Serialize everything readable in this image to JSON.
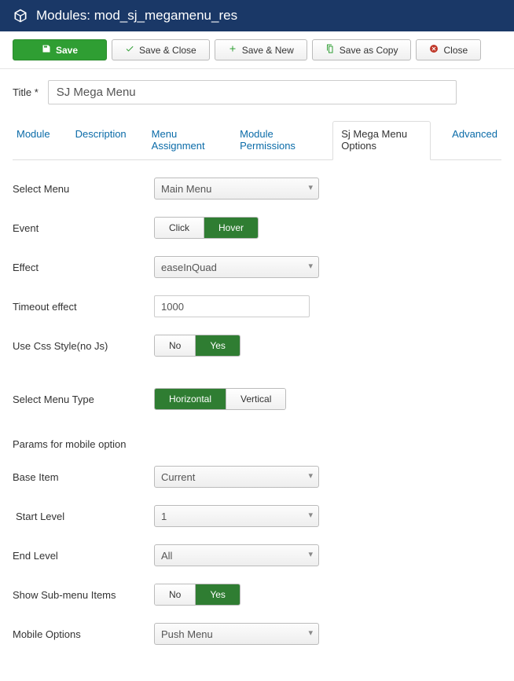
{
  "header": {
    "title": "Modules: mod_sj_megamenu_res"
  },
  "toolbar": {
    "save": "Save",
    "save_close": "Save & Close",
    "save_new": "Save & New",
    "save_copy": "Save as Copy",
    "close": "Close"
  },
  "title_field": {
    "label": "Title *",
    "value": "SJ Mega Menu"
  },
  "tabs": {
    "module": "Module",
    "description": "Description",
    "menu_assignment": "Menu Assignment",
    "module_permissions": "Module Permissions",
    "sj_options": "Sj Mega Menu Options",
    "advanced": "Advanced"
  },
  "form": {
    "select_menu": {
      "label": "Select Menu",
      "value": "Main Menu"
    },
    "event": {
      "label": "Event",
      "option_a": "Click",
      "option_b": "Hover"
    },
    "effect": {
      "label": "Effect",
      "value": "easeInQuad"
    },
    "timeout": {
      "label": "Timeout effect",
      "value": "1000"
    },
    "use_css": {
      "label": "Use Css Style(no Js)",
      "option_a": "No",
      "option_b": "Yes"
    },
    "select_menu_type": {
      "label": "Select Menu Type",
      "option_a": "Horizontal",
      "option_b": "Vertical"
    },
    "mobile_heading": "Params for mobile option",
    "base_item": {
      "label": "Base Item",
      "value": "Current"
    },
    "start_level": {
      "label": "Start Level",
      "value": "1"
    },
    "end_level": {
      "label": "End Level",
      "value": "All"
    },
    "show_submenu": {
      "label": "Show Sub-menu Items",
      "option_a": "No",
      "option_b": "Yes"
    },
    "mobile_options": {
      "label": "Mobile Options",
      "value": "Push Menu"
    }
  }
}
